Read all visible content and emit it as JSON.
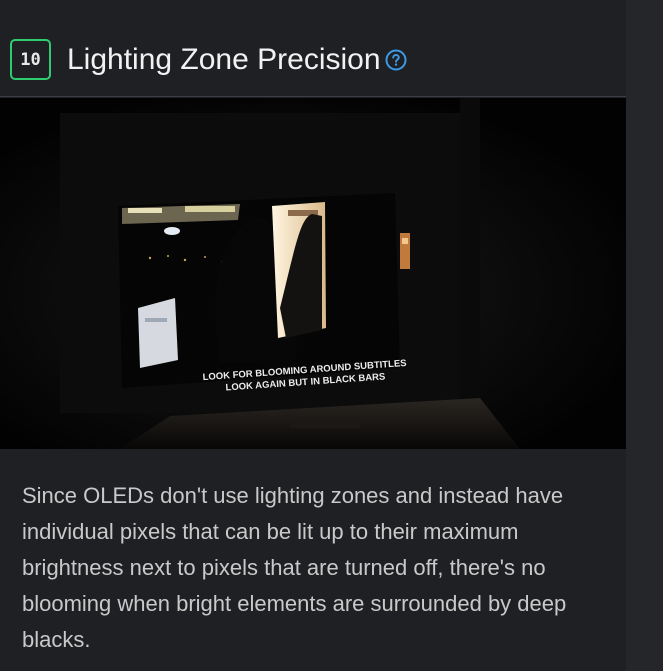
{
  "section": {
    "score": "10",
    "title": "Lighting Zone Precision",
    "help_icon": "question-circle-icon",
    "accent_color": "#2ecc71",
    "help_color": "#3b9be8"
  },
  "photo": {
    "subtitle_line1": "LOOK FOR BLOOMING AROUND SUBTITLES",
    "subtitle_line2": "LOOK AGAIN BUT IN BLACK BARS"
  },
  "description": "Since OLEDs don't use lighting zones and instead have individual pixels that can be lit up to their maximum brightness next to pixels that are turned off, there's no blooming when bright elements are surrounded by deep blacks."
}
